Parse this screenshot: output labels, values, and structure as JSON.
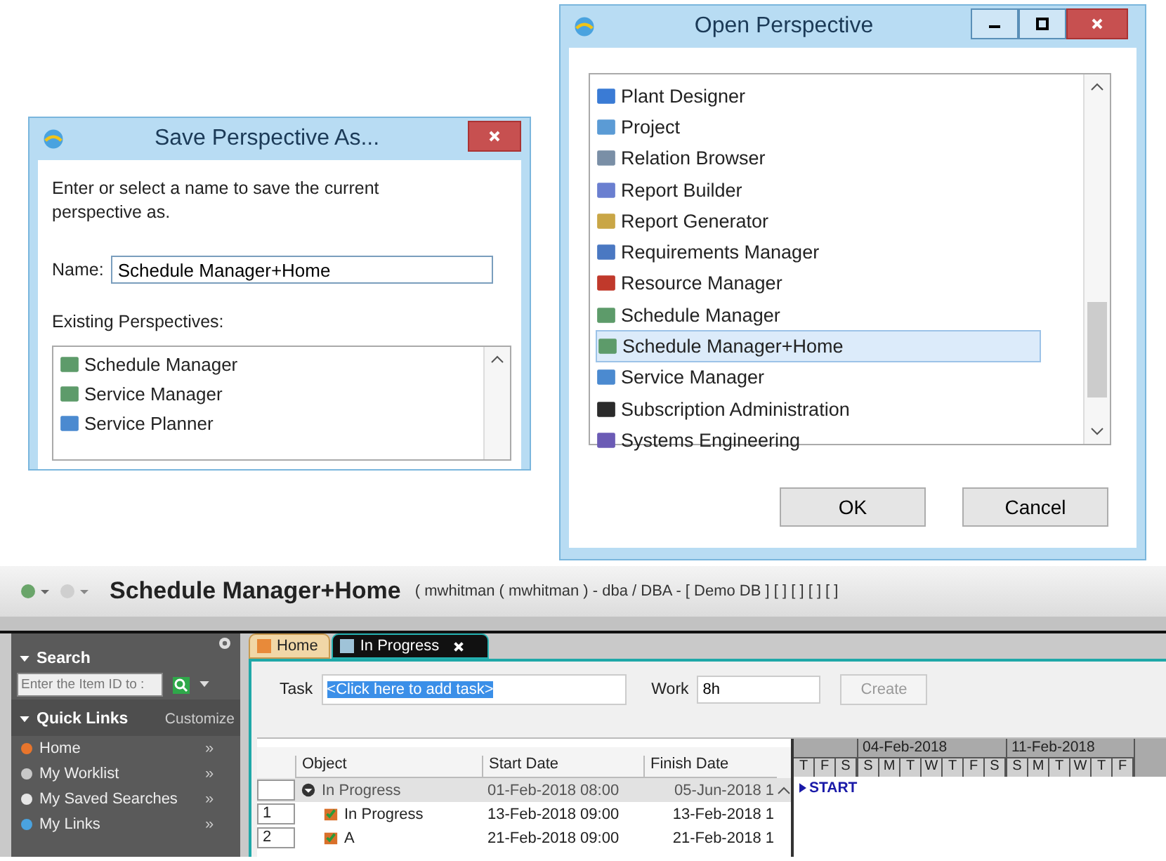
{
  "save_dialog": {
    "title": "Save Perspective As...",
    "instruction": "Enter or select a name to save the current perspective as.",
    "name_label": "Name:",
    "name_value": "Schedule Manager+Home",
    "list_label": "Existing Perspectives:",
    "perspectives": [
      {
        "label": "Schedule Manager",
        "selected": false
      },
      {
        "label": "Service Manager",
        "selected": false
      },
      {
        "label": "Service Planner",
        "selected": false
      }
    ]
  },
  "open_dialog": {
    "title": "Open Perspective",
    "perspectives": [
      {
        "label": "Plant Designer",
        "selected": false
      },
      {
        "label": "Project",
        "selected": false
      },
      {
        "label": "Relation Browser",
        "selected": false
      },
      {
        "label": "Report Builder",
        "selected": false
      },
      {
        "label": "Report Generator",
        "selected": false
      },
      {
        "label": "Requirements Manager",
        "selected": false
      },
      {
        "label": "Resource Manager",
        "selected": false
      },
      {
        "label": "Schedule Manager",
        "selected": false
      },
      {
        "label": "Schedule Manager+Home",
        "selected": true
      },
      {
        "label": "Service Manager",
        "selected": false
      },
      {
        "label": "Subscription Administration",
        "selected": false
      },
      {
        "label": "Systems Engineering",
        "selected": false
      }
    ],
    "buttons": [
      "OK",
      "Cancel"
    ]
  },
  "app": {
    "title": "Schedule Manager+Home",
    "subtitle": "( mwhitman ( mwhitman ) - dba / DBA - [ Demo DB ] [ ] [ ] [ ] [ ]",
    "sidebar": {
      "search_header": "Search",
      "search_placeholder": "Enter the Item ID to :",
      "quick_links_header": "Quick Links",
      "customize": "Customize",
      "links": [
        {
          "label": "Home",
          "chevron": "»"
        },
        {
          "label": "My Worklist",
          "chevron": "»"
        },
        {
          "label": "My Saved Searches",
          "chevron": "»"
        },
        {
          "label": "My Links",
          "chevron": "»"
        }
      ]
    },
    "tabs": [
      {
        "label": "Home",
        "selected": false,
        "closable": false
      },
      {
        "label": "In Progress",
        "selected": true,
        "closable": true
      }
    ],
    "task": {
      "label": "Task",
      "value": "<Click here to add task>"
    },
    "work": {
      "label": "Work",
      "value": "8h"
    },
    "create_button": {
      "label": "Create",
      "disabled": true
    },
    "table": {
      "columns": [
        "Object",
        "Start Date",
        "Finish Date"
      ],
      "rows": [
        {
          "kind": "summary",
          "object": "In Progress",
          "start": "01-Feb-2018 08:00",
          "finish": "05-Jun-2018 1"
        },
        {
          "kind": "task",
          "number": "1",
          "object": "In Progress",
          "start": "13-Feb-2018 09:00",
          "finish": "13-Feb-2018 1"
        },
        {
          "kind": "task",
          "number": "2",
          "object": "A",
          "start": "21-Feb-2018 09:00",
          "finish": "21-Feb-2018 1"
        }
      ]
    },
    "gantt": {
      "weeks": [
        {
          "days": [
            "T",
            "F",
            "S"
          ]
        },
        {
          "label": "04-Feb-2018",
          "days": [
            "S",
            "M",
            "T",
            "W",
            "T",
            "F",
            "S"
          ]
        },
        {
          "label": "11-Feb-2018",
          "days": [
            "S",
            "M",
            "T",
            "W",
            "T",
            "F"
          ]
        }
      ],
      "start_marker": "START"
    }
  }
}
